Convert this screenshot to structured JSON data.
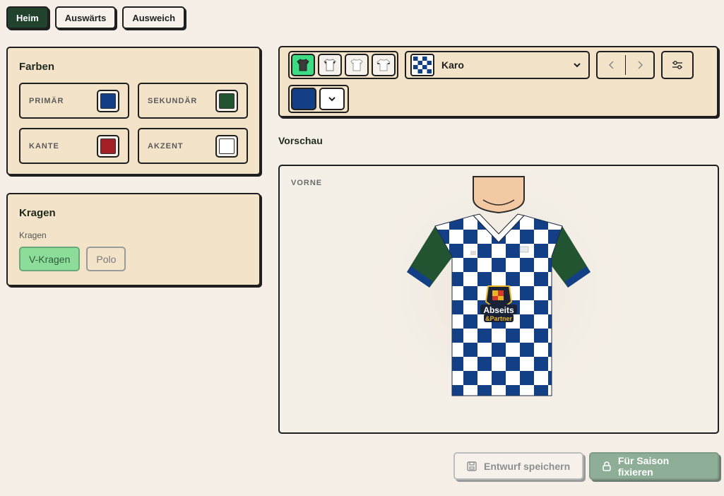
{
  "kit_tabs": [
    {
      "label": "Heim",
      "active": true
    },
    {
      "label": "Auswärts",
      "active": false
    },
    {
      "label": "Ausweich",
      "active": false
    }
  ],
  "colors": {
    "title": "Farben",
    "items": [
      {
        "label": "PRIMÄR",
        "color": "#123f86"
      },
      {
        "label": "SEKUNDÄR",
        "color": "#235431"
      },
      {
        "label": "KANTE",
        "color": "#a31f25"
      },
      {
        "label": "AKZENT",
        "color": "#ffffff"
      }
    ]
  },
  "collar": {
    "title": "Kragen",
    "label": "Kragen",
    "options": [
      {
        "label": "V-Kragen",
        "active": true
      },
      {
        "label": "Polo",
        "active": false
      }
    ]
  },
  "toolbar": {
    "views": [
      "shirt-dark-icon",
      "shirt-white-icon",
      "shirt-white-icon",
      "shirt-white-icon"
    ],
    "pattern": {
      "name": "Karo",
      "icon": "checkered-icon"
    },
    "pattern_color": "#123f86"
  },
  "preview": {
    "section_label": "Vorschau",
    "view_label": "VORNE",
    "sponsor_line1": "Abseits",
    "sponsor_line2": "&Partner"
  },
  "footer": {
    "save_label": "Entwurf speichern",
    "fix_label": "Für Saison fixieren"
  },
  "brand_colors": {
    "primary": "#123f86",
    "secondary": "#235431",
    "accent_green": "#3ddc84",
    "panel_bg": "#f3e3c8",
    "page_bg": "#f5efe7"
  }
}
